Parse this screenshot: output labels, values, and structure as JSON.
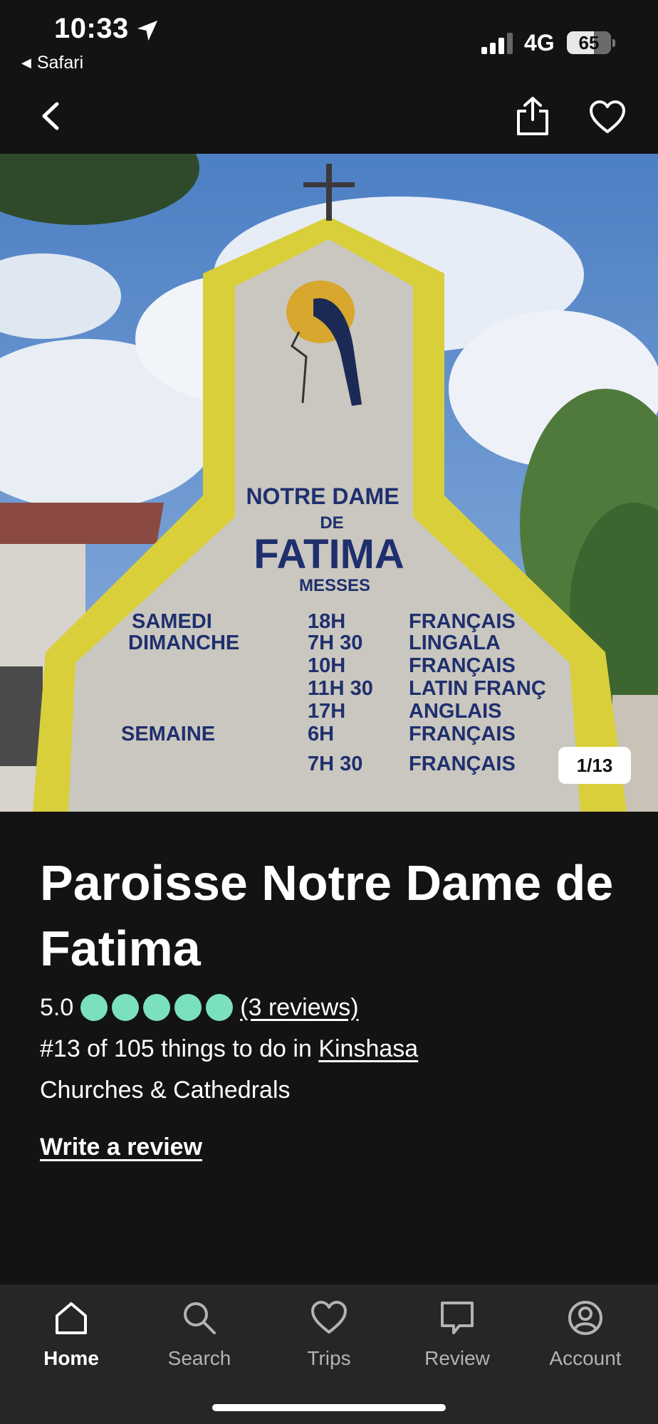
{
  "status_bar": {
    "time": "10:33",
    "back_app": "Safari",
    "network": "4G",
    "battery": "65"
  },
  "nav": {
    "icons": [
      "back-chevron-icon",
      "share-icon",
      "heart-icon"
    ]
  },
  "photo": {
    "counter": "1/13",
    "sign": {
      "line1": "NOTRE DAME",
      "line2": "DE",
      "line3": "FATIMA",
      "line4": "MESSES",
      "schedule": [
        {
          "day": "SAMEDI",
          "time": "18H",
          "lang": "FRANÇAIS"
        },
        {
          "day": "DIMANCHE",
          "time": "7H 30",
          "lang": "LINGALA"
        },
        {
          "day": "",
          "time": "10H",
          "lang": "FRANÇAIS"
        },
        {
          "day": "",
          "time": "11H 30",
          "lang": "LATIN FRANÇ"
        },
        {
          "day": "",
          "time": "17H",
          "lang": "ANGLAIS"
        },
        {
          "day": "SEMAINE",
          "time": "6H",
          "lang": "FRANÇAIS"
        },
        {
          "day": "",
          "time": "7H 30",
          "lang": "FRANÇAIS"
        }
      ]
    }
  },
  "listing": {
    "title": "Paroisse Notre Dame de Fatima",
    "rating": "5.0",
    "rating_bubbles": 5,
    "bubble_color": "#7be0bf",
    "reviews_link": "(3 reviews)",
    "rank_prefix": "#13 of 105 things to do in ",
    "rank_city": "Kinshasa",
    "category": "Churches & Cathedrals",
    "write_review": "Write a review"
  },
  "tab_bar": {
    "tabs": [
      {
        "label": "Home",
        "icon": "home-icon",
        "active": true
      },
      {
        "label": "Search",
        "icon": "search-icon",
        "active": false
      },
      {
        "label": "Trips",
        "icon": "heart-icon",
        "active": false
      },
      {
        "label": "Review",
        "icon": "speech-bubble-icon",
        "active": false
      },
      {
        "label": "Account",
        "icon": "user-circle-icon",
        "active": false
      }
    ]
  }
}
